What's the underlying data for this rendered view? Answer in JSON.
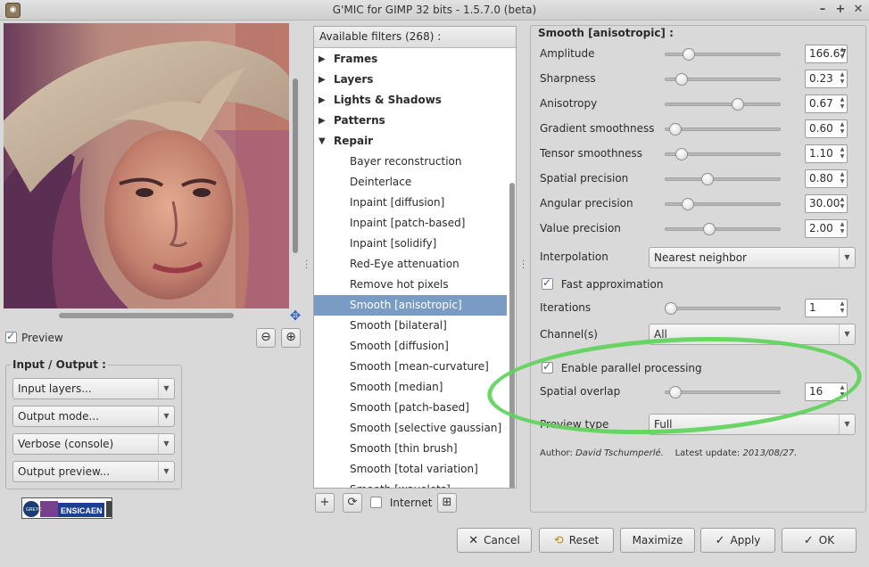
{
  "window": {
    "title": "G'MIC for GIMP 32 bits - 1.5.7.0 (beta)",
    "controls": [
      "▾",
      "–",
      "+",
      "✕"
    ]
  },
  "left": {
    "preview_label": "Preview",
    "zoom_out": "⊖",
    "zoom_in": "⊕",
    "io_title": "Input / Output :",
    "io_combos": [
      "Input layers...",
      "Output mode...",
      "Verbose (console)",
      "Output preview..."
    ],
    "logo_text": "ENSICAEN",
    "logo_badge": "GREYC"
  },
  "filters": {
    "header": "Available filters (268) :",
    "folders": [
      {
        "label": "Frames",
        "open": false
      },
      {
        "label": "Layers",
        "open": false
      },
      {
        "label": "Lights & Shadows",
        "open": false
      },
      {
        "label": "Patterns",
        "open": false
      },
      {
        "label": "Repair",
        "open": true
      }
    ],
    "items": [
      "Bayer reconstruction",
      "Deinterlace",
      "Inpaint [diffusion]",
      "Inpaint [patch-based]",
      "Inpaint [solidify]",
      "Red-Eye attenuation",
      "Remove hot pixels",
      "Smooth [anisotropic]",
      "Smooth [bilateral]",
      "Smooth [diffusion]",
      "Smooth [mean-curvature]",
      "Smooth [median]",
      "Smooth [patch-based]",
      "Smooth [selective gaussian]",
      "Smooth [thin brush]",
      "Smooth [total variation]",
      "Smooth [wavelets]"
    ],
    "selected_index": 7,
    "add_label": "+",
    "refresh_label": "⟳",
    "internet_label": "Internet",
    "expand_label": "⊞"
  },
  "params": {
    "title": "Smooth [anisotropic] :",
    "sliders": [
      {
        "label": "Amplitude",
        "value": "166.67",
        "fraction": 0.17
      },
      {
        "label": "Sharpness",
        "value": "0.23",
        "fraction": 0.1
      },
      {
        "label": "Anisotropy",
        "value": "0.67",
        "fraction": 0.65
      },
      {
        "label": "Gradient smoothness",
        "value": "0.60",
        "fraction": 0.04
      },
      {
        "label": "Tensor smoothness",
        "value": "1.10",
        "fraction": 0.1
      },
      {
        "label": "Spatial precision",
        "value": "0.80",
        "fraction": 0.35
      },
      {
        "label": "Angular precision",
        "value": "30.00",
        "fraction": 0.16
      },
      {
        "label": "Value precision",
        "value": "2.00",
        "fraction": 0.37
      }
    ],
    "interpolation_label": "Interpolation",
    "interpolation_value": "Nearest neighbor",
    "fast_approx_label": "Fast approximation",
    "iterations_label": "Iterations",
    "iterations_value": "1",
    "iterations_fraction": 0.0,
    "channels_label": "Channel(s)",
    "channels_value": "All",
    "parallel_label": "Enable parallel processing",
    "overlap_label": "Spatial overlap",
    "overlap_value": "16",
    "overlap_fraction": 0.04,
    "preview_type_label": "Preview type",
    "preview_type_value": "Full",
    "author_label": "Author:",
    "author_name": "David Tschumperlé.",
    "update_label": "Latest update:",
    "update_date": "2013/08/27."
  },
  "buttons": {
    "cancel": "Cancel",
    "reset": "Reset",
    "maximize": "Maximize",
    "apply": "Apply",
    "ok": "OK"
  },
  "colors": {
    "selection": "#7a9cc4",
    "annotation_ellipse": "#5fd45b"
  }
}
